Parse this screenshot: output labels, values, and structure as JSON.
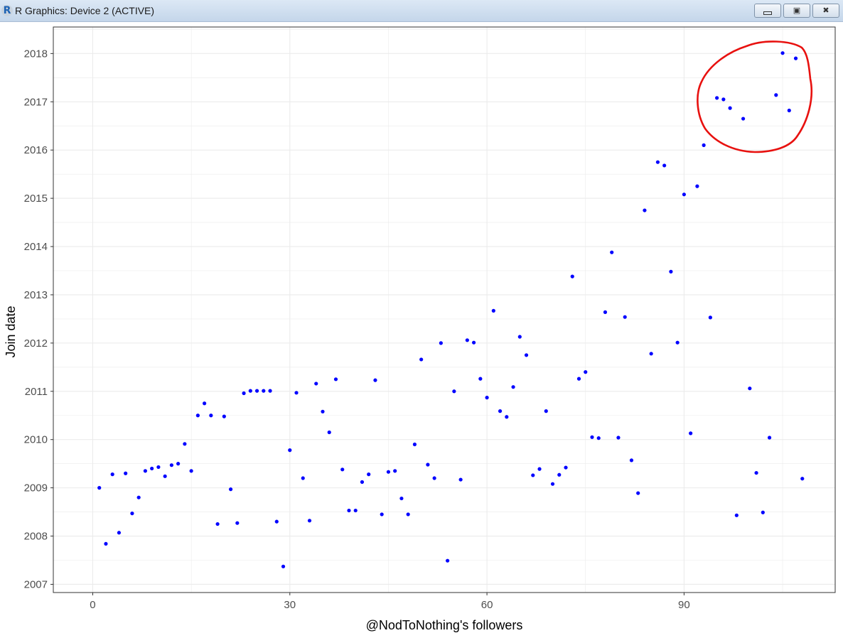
{
  "window": {
    "title": "R Graphics: Device 2 (ACTIVE)",
    "icon": "r-logo-icon",
    "buttons": {
      "minimize_icon": "minimize-icon",
      "maximize_icon": "maximize-icon",
      "close_icon": "close-icon"
    }
  },
  "colors": {
    "points": "#0000ff",
    "highlight_circle": "#e8110f",
    "gridline": "#ebebeb",
    "panel_border": "#333333"
  },
  "chart_data": {
    "type": "scatter",
    "title": "",
    "xlabel": "@NodToNothing's followers",
    "ylabel": "Join date",
    "xlim": [
      -6,
      113
    ],
    "ylim": [
      2006.83,
      2018.55
    ],
    "xticks": [
      0,
      30,
      60,
      90
    ],
    "xtick_labels": [
      "0",
      "30",
      "60",
      "90"
    ],
    "yticks": [
      2007,
      2008,
      2009,
      2010,
      2011,
      2012,
      2013,
      2014,
      2015,
      2016,
      2017,
      2018
    ],
    "ytick_labels": [
      "2007",
      "2008",
      "2009",
      "2010",
      "2011",
      "2012",
      "2013",
      "2014",
      "2015",
      "2016",
      "2017",
      "2018"
    ],
    "grid": true,
    "legend": "none",
    "annotation": "hand-drawn red circle around the points with x from 95 to 107",
    "series": [
      {
        "x": [
          1,
          2,
          3,
          4,
          5,
          6,
          7,
          8,
          9,
          10,
          11,
          12,
          13,
          14,
          15,
          16,
          17,
          18,
          19,
          20,
          21,
          22,
          23,
          24,
          25,
          26,
          27,
          28,
          29,
          30,
          31,
          32,
          33,
          34,
          35,
          36,
          37,
          38,
          39,
          40,
          41,
          42,
          43,
          44,
          45,
          46,
          47,
          48,
          49,
          50,
          51,
          52,
          53,
          54,
          55,
          56,
          57,
          58,
          59,
          60,
          61,
          62,
          63,
          64,
          65,
          66,
          67,
          68,
          69,
          70,
          71,
          72,
          73,
          74,
          75,
          76,
          77,
          78,
          79,
          80,
          81,
          82,
          83,
          84,
          85,
          86,
          87,
          88,
          89,
          90,
          91,
          92,
          93,
          94,
          95,
          96,
          97,
          98,
          99,
          100,
          101,
          102,
          103,
          104,
          105,
          106,
          107,
          108
        ],
        "y": [
          2009.0,
          2007.84,
          2009.28,
          2008.07,
          2009.3,
          2008.47,
          2008.8,
          2009.35,
          2009.4,
          2009.43,
          2009.24,
          2009.47,
          2009.5,
          2009.91,
          2009.35,
          2010.5,
          2010.75,
          2010.5,
          2008.25,
          2010.48,
          2008.97,
          2008.27,
          2010.96,
          2011.01,
          2011.01,
          2011.01,
          2011.01,
          2008.3,
          2007.37,
          2009.78,
          2010.97,
          2009.2,
          2008.32,
          2011.16,
          2010.58,
          2010.15,
          2011.25,
          2009.38,
          2008.53,
          2008.53,
          2009.12,
          2009.28,
          2011.23,
          2008.45,
          2009.33,
          2009.35,
          2008.78,
          2008.45,
          2009.9,
          2011.66,
          2009.48,
          2009.2,
          2012.0,
          2007.49,
          2011.0,
          2009.17,
          2012.06,
          2012.01,
          2011.26,
          2010.87,
          2012.67,
          2010.59,
          2010.47,
          2011.09,
          2012.13,
          2011.75,
          2009.26,
          2009.39,
          2010.59,
          2009.08,
          2009.27,
          2009.42,
          2013.38,
          2011.26,
          2011.4,
          2010.05,
          2010.03,
          2012.64,
          2013.88,
          2010.04,
          2012.54,
          2009.57,
          2008.89,
          2014.75,
          2011.78,
          2015.75,
          2015.68,
          2013.48,
          2012.01,
          2015.08,
          2010.13,
          2015.25,
          2016.1,
          2012.53,
          2017.08,
          2017.05,
          2016.87,
          2008.43,
          2016.65,
          2011.06,
          2009.31,
          2008.49,
          2010.04,
          2017.14,
          2018.01,
          2016.82,
          2017.9,
          2009.19
        ]
      }
    ]
  }
}
